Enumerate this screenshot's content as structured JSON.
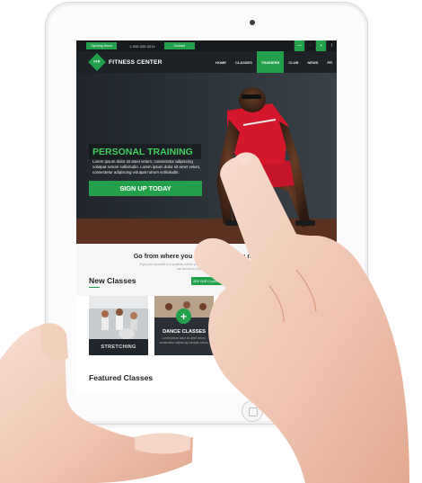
{
  "site": {
    "topbar": {
      "btn_left": "Opening Hours",
      "phone": "1-900-000-0014",
      "btn_contact": "Contact"
    },
    "logo_mark": "GYM",
    "logo_text": "FITNESS CENTER",
    "nav": [
      "HOME",
      "CLASSES",
      "TRAINERS",
      "CLUB",
      "NEWS",
      "PR"
    ],
    "nav_active": "TRAINERS",
    "hero": {
      "title": "PERSONAL TRAINING",
      "body": "Lorem ipsum dolor sit amet velum, consectetur adipiscing volutpat rutrum sollicitudin. Lorem ipsum dolor sit amet velum, consectetur adipiscing volutpat rutrum sollicitudin.",
      "cta": "SIGN UP TODAY"
    },
    "intro": {
      "title": "Go from where you are to where you need to be",
      "sub": "If you put yourself in a position where you have to stretch outside your comfort zone, then you are forced to expand your consciousness.",
      "btn": "SEE OUR CLASSES"
    },
    "new_classes": {
      "title": "New Classes",
      "cards": [
        {
          "label": "STRETCHING"
        },
        {
          "label": "DANCE CLASSES",
          "desc": "Lorem ipsum dolor sit amet velum, consectetur adipiscing volutpat rutrum."
        }
      ]
    },
    "featured_title": "Featured Classes"
  },
  "colors": {
    "accent": "#23a14a",
    "dark": "#1d2226"
  },
  "icons": [
    "camera-icon",
    "home-button-icon",
    "plus-icon",
    "social-icons"
  ]
}
